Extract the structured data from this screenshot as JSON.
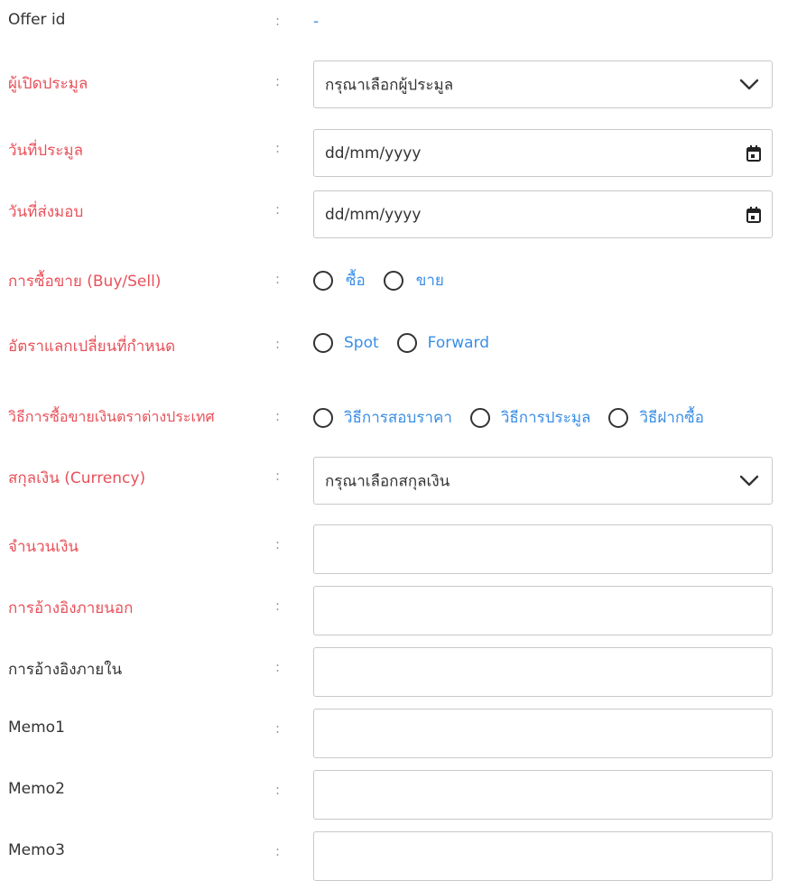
{
  "form": {
    "offer_id": {
      "label": "Offer id",
      "colon": ":",
      "value": "-"
    },
    "opener": {
      "label": "ผู้เปิดประมูล",
      "colon": ":",
      "placeholder": "กรุณาเลือกผู้ประมูล"
    },
    "auction_date": {
      "label": "วันที่ประมูล",
      "colon": ":",
      "value": "dd/mm/yyyy"
    },
    "delivery_date": {
      "label": "วันที่ส่งมอบ",
      "colon": ":",
      "value": "dd/mm/yyyy"
    },
    "buy_sell": {
      "label": "การซื้อขาย (Buy/Sell)",
      "colon": ":",
      "options": [
        "ซื้อ",
        "ขาย"
      ]
    },
    "rate": {
      "label": "อัตราแลกเปลี่ยนที่กำหนด",
      "colon": ":",
      "options": [
        "Spot",
        "Forward"
      ]
    },
    "method": {
      "label": "วิธีการซื้อขายเงินตราต่างประเทศ",
      "colon": ":",
      "options": [
        "วิธีการสอบราคา",
        "วิธีการประมูล",
        "วิธีฝากซื้อ"
      ]
    },
    "currency": {
      "label": "สกุลเงิน (Currency)",
      "colon": ":",
      "placeholder": "กรุณาเลือกสกุลเงิน"
    },
    "amount": {
      "label": "จำนวนเงิน",
      "colon": ":"
    },
    "ext_ref": {
      "label": "การอ้างอิงภายนอก",
      "colon": ":"
    },
    "int_ref": {
      "label": "การอ้างอิงภายใน",
      "colon": ":"
    },
    "memo1": {
      "label": "Memo1",
      "colon": ":"
    },
    "memo2": {
      "label": "Memo2",
      "colon": ":"
    },
    "memo3": {
      "label": "Memo3",
      "colon": ":"
    }
  },
  "colors": {
    "required_label": "#e8515a",
    "radio_label": "#3a8ee6",
    "border": "#c9c9c9"
  },
  "icons": {
    "select": "chevron-down-icon",
    "date": "calendar-icon",
    "radio": "radio-circle"
  }
}
